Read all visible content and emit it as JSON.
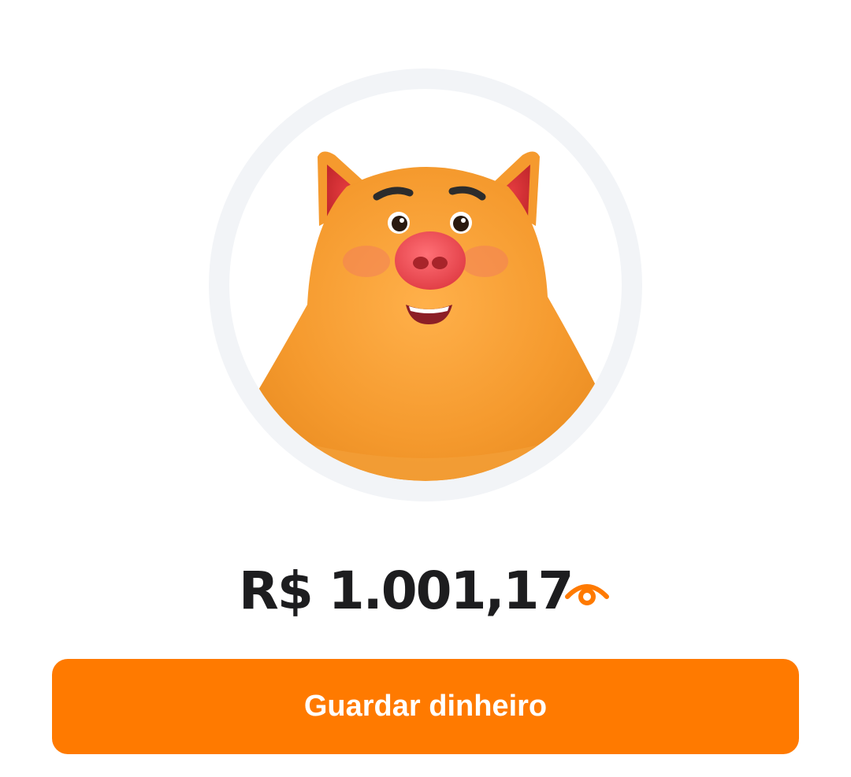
{
  "savings": {
    "mascot": "piggy-bank-mascot",
    "balance": "R$ 1.001,17",
    "visibility_icon": "eye-icon",
    "action_label": "Guardar dinheiro"
  },
  "colors": {
    "accent": "#ff7a00",
    "mascot_body": "#f59a2e",
    "mascot_snout": "#e8454c",
    "ring": "#f2f4f7",
    "text": "#1d1d1f"
  }
}
